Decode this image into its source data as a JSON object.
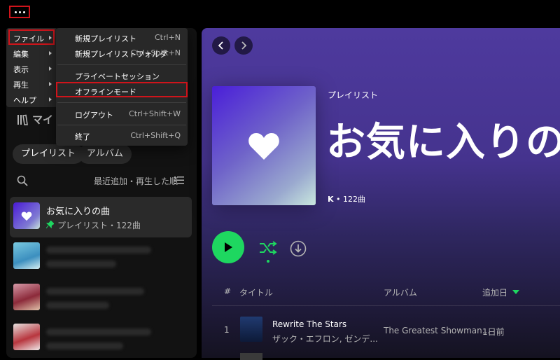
{
  "colors": {
    "accent": "#1ed760",
    "highlight_box": "#d0141b",
    "menu_bg": "#282828",
    "sidebar_bg": "#121212"
  },
  "menu": {
    "top": [
      {
        "label": "ファイル"
      },
      {
        "label": "編集"
      },
      {
        "label": "表示"
      },
      {
        "label": "再生"
      },
      {
        "label": "ヘルプ"
      }
    ],
    "file_submenu": [
      {
        "label": "新規プレイリスト",
        "shortcut": "Ctrl+N"
      },
      {
        "label": "新規プレイリストフォルダ",
        "shortcut": "Ctrl+Shift+N"
      },
      {
        "label": "プライベートセッション",
        "shortcut": ""
      },
      {
        "label": "オフラインモード",
        "shortcut": ""
      },
      {
        "label": "ログアウト",
        "shortcut": "Ctrl+Shift+W"
      },
      {
        "label": "終了",
        "shortcut": "Ctrl+Shift+Q"
      }
    ]
  },
  "sidebar": {
    "library_title": "マイ",
    "chips": [
      "プレイリスト",
      "アルバム"
    ],
    "sort_label": "最近追加・再生した順",
    "liked": {
      "title": "お気に入りの曲",
      "subtitle": "プレイリスト・122曲"
    }
  },
  "playlist": {
    "type": "プレイリスト",
    "title": "お気に入りの",
    "owner": "K",
    "meta": " • 122曲"
  },
  "table": {
    "headers": {
      "num": "#",
      "title": "タイトル",
      "album": "アルバム",
      "added": "追加日"
    },
    "rows": [
      {
        "num": "1",
        "title": "Rewrite The Stars",
        "artist": "ザック・エフロン, ゼンデ...",
        "album": "The Greatest Showman...",
        "added": "1日前"
      }
    ]
  }
}
